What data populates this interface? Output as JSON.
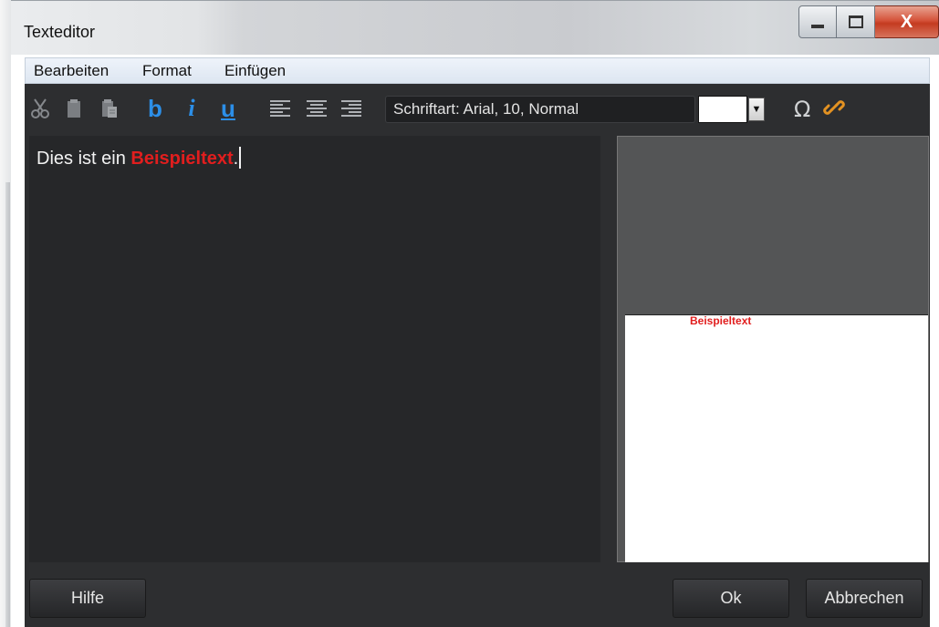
{
  "window": {
    "title": "Texteditor",
    "controls": {
      "minimize": "",
      "maximize": "",
      "close": "X"
    }
  },
  "menu": {
    "items": [
      "Bearbeiten",
      "Format",
      "Einfügen"
    ]
  },
  "toolbar": {
    "icons": {
      "cut": "scissors-icon",
      "copy": "copy-icon",
      "paste": "paste-icon",
      "bold": "b",
      "italic": "i",
      "underline": "u",
      "align_left": "align-left-icon",
      "align_center": "align-center-icon",
      "align_right": "align-right-icon",
      "special_char": "Ω",
      "link": "link-icon"
    },
    "font_label": "Schriftart: Arial, 10, Normal",
    "color_value": "#ffffff"
  },
  "editor": {
    "text_before": "Dies ist ein ",
    "text_highlight": "Beispieltext",
    "text_after": ".",
    "highlight_color": "#e11e1e"
  },
  "preview": {
    "text": "Beispieltext"
  },
  "footer": {
    "help_label": "Hilfe",
    "ok_label": "Ok",
    "cancel_label": "Abbrechen"
  }
}
